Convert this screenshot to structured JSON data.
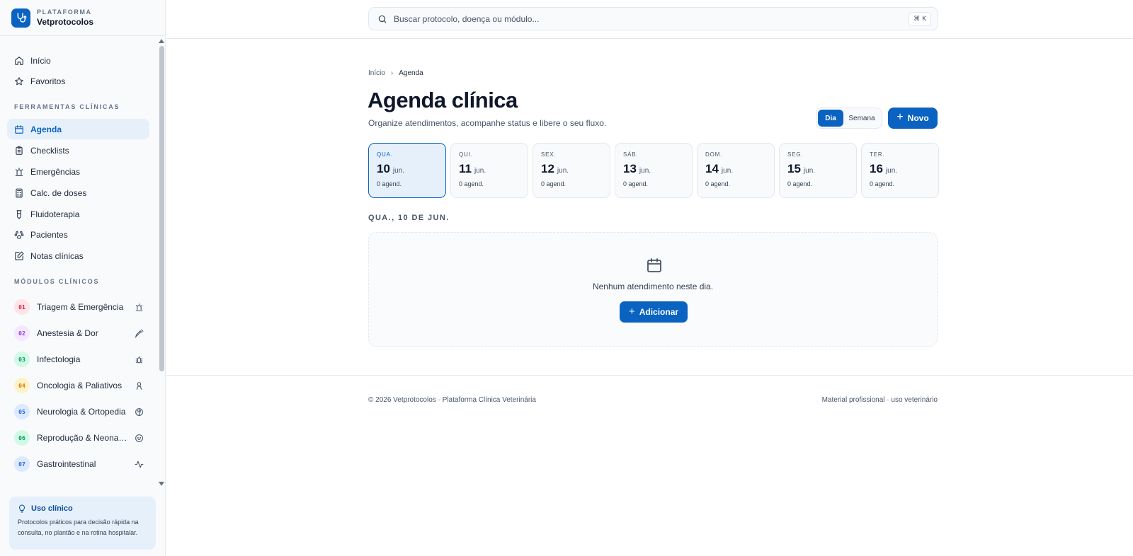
{
  "brand": {
    "kicker": "PLATAFORMA",
    "name": "Vetprotocolos"
  },
  "nav": {
    "main": [
      {
        "label": "Início",
        "icon": "home-icon"
      },
      {
        "label": "Favoritos",
        "icon": "star-icon"
      }
    ],
    "tools_title": "FERRAMENTAS CLÍNICAS",
    "tools": [
      {
        "label": "Agenda",
        "icon": "calendar-icon",
        "active": true
      },
      {
        "label": "Checklists",
        "icon": "clipboard-icon"
      },
      {
        "label": "Emergências",
        "icon": "siren-icon"
      },
      {
        "label": "Calc. de doses",
        "icon": "calculator-icon"
      },
      {
        "label": "Fluidoterapia",
        "icon": "iv-bag-icon"
      },
      {
        "label": "Pacientes",
        "icon": "paw-icon"
      },
      {
        "label": "Notas clínicas",
        "icon": "note-edit-icon"
      }
    ],
    "modules_title": "MÓDULOS CLÍNICOS",
    "modules": [
      {
        "num": "01",
        "label": "Triagem & Emergência",
        "color": "#e11d48",
        "bg": "#ffe4e6",
        "icon": "siren-icon"
      },
      {
        "num": "02",
        "label": "Anestesia & Dor",
        "color": "#9333ea",
        "bg": "#f3e8ff",
        "icon": "syringe-icon"
      },
      {
        "num": "03",
        "label": "Infectologia",
        "color": "#059669",
        "bg": "#d1fae5",
        "icon": "bug-icon"
      },
      {
        "num": "04",
        "label": "Oncologia & Paliativos",
        "color": "#d97706",
        "bg": "#fef3c7",
        "icon": "ribbon-icon"
      },
      {
        "num": "05",
        "label": "Neurologia & Ortopedia",
        "color": "#2563eb",
        "bg": "#dbeafe",
        "icon": "brain-icon"
      },
      {
        "num": "06",
        "label": "Reprodução & Neonatologia",
        "color": "#059669",
        "bg": "#d1fae5",
        "icon": "baby-icon"
      },
      {
        "num": "07",
        "label": "Gastrointestinal",
        "color": "#2563eb",
        "bg": "#dbeafe",
        "icon": "activity-icon"
      }
    ]
  },
  "use_card": {
    "title": "Uso clínico",
    "desc": "Protocolos práticos para decisão rápida na consulta, no plantão e na rotina hospitalar."
  },
  "search": {
    "placeholder": "Buscar protocolo, doença ou módulo...",
    "shortcut": "⌘ K"
  },
  "breadcrumb": {
    "home": "Início",
    "current": "Agenda"
  },
  "page": {
    "title": "Agenda clínica",
    "subtitle": "Organize atendimentos, acompanhe status e libere o seu fluxo."
  },
  "view_toggle": {
    "day": "Dia",
    "week": "Semana"
  },
  "new_button": "Novo",
  "days": [
    {
      "weekday": "QUA.",
      "num": "10",
      "month": "jun.",
      "count": "0 agend.",
      "selected": true
    },
    {
      "weekday": "QUI.",
      "num": "11",
      "month": "jun.",
      "count": "0 agend."
    },
    {
      "weekday": "SEX.",
      "num": "12",
      "month": "jun.",
      "count": "0 agend."
    },
    {
      "weekday": "SÁB.",
      "num": "13",
      "month": "jun.",
      "count": "0 agend."
    },
    {
      "weekday": "DOM.",
      "num": "14",
      "month": "jun.",
      "count": "0 agend."
    },
    {
      "weekday": "SEG.",
      "num": "15",
      "month": "jun.",
      "count": "0 agend."
    },
    {
      "weekday": "TER.",
      "num": "16",
      "month": "jun.",
      "count": "0 agend."
    }
  ],
  "selected_day_heading": "QUA., 10 DE JUN.",
  "empty": {
    "text": "Nenhum atendimento neste dia.",
    "button": "Adicionar"
  },
  "footer": {
    "left": "© 2026 Vetprotocolos · Plataforma Clínica Veterinária",
    "right": "Material profissional · uso veterinário"
  },
  "colors": {
    "accent": "#0a63c0",
    "accent_soft": "#e6f0fb"
  }
}
